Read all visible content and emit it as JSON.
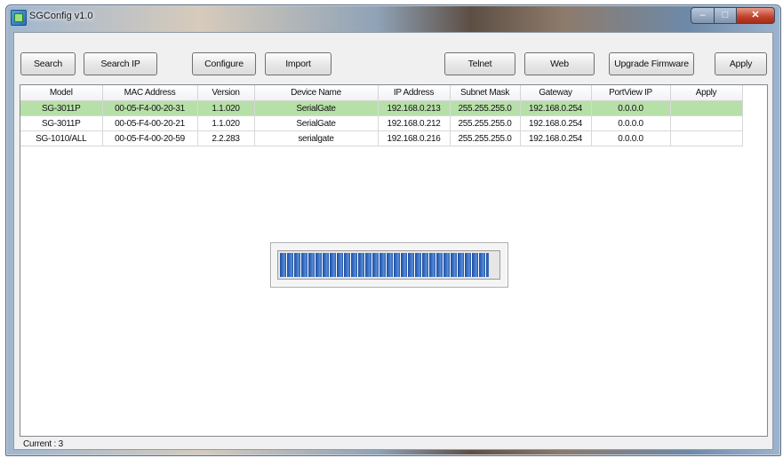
{
  "window": {
    "title": "SGConfig v1.0"
  },
  "toolbar": {
    "search": "Search",
    "search_ip": "Search IP",
    "configure": "Configure",
    "import": "Import",
    "telnet": "Telnet",
    "web": "Web",
    "upgrade_firmware": "Upgrade Firmware",
    "apply": "Apply"
  },
  "table": {
    "columns": [
      "Model",
      "MAC Address",
      "Version",
      "Device Name",
      "IP Address",
      "Subnet Mask",
      "Gateway",
      "PortView IP",
      "Apply"
    ],
    "rows": [
      [
        "SG-3011P",
        "00-05-F4-00-20-31",
        "1.1.020",
        "SerialGate",
        "192.168.0.213",
        "255.255.255.0",
        "192.168.0.254",
        "0.0.0.0",
        ""
      ],
      [
        "SG-3011P",
        "00-05-F4-00-20-21",
        "1.1.020",
        "SerialGate",
        "192.168.0.212",
        "255.255.255.0",
        "192.168.0.254",
        "0.0.0.0",
        ""
      ],
      [
        "SG-1010/ALL",
        "00-05-F4-00-20-59",
        "2.2.283",
        "serialgate",
        "192.168.0.216",
        "255.255.255.0",
        "192.168.0.254",
        "0.0.0.0",
        ""
      ]
    ],
    "selected_row": 0
  },
  "progress": {
    "fraction": 0.96
  },
  "status": {
    "text": "Current : 3"
  },
  "colors": {
    "selected_row": "#b7e0a8",
    "progress": "#2d5fb0"
  }
}
